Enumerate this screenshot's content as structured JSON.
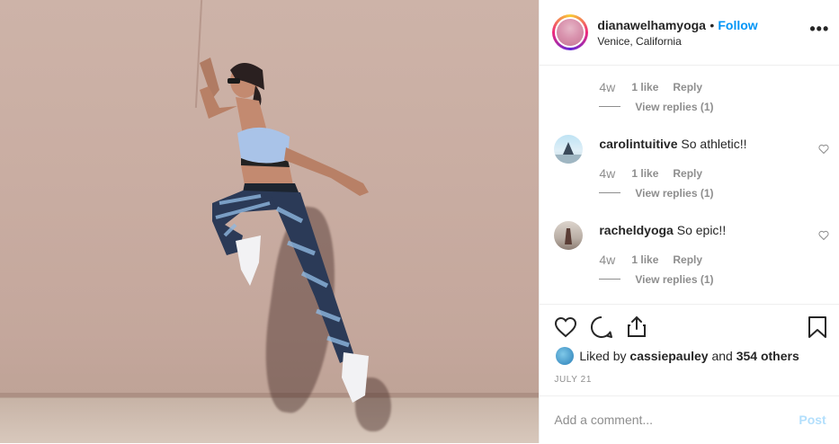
{
  "header": {
    "username": "dianawelhamyoga",
    "separator": "•",
    "follow_label": "Follow",
    "location": "Venice, California",
    "more_label": "•••"
  },
  "comments": [
    {
      "username": "",
      "text": "",
      "time": "4w",
      "likes": "1 like",
      "reply_label": "Reply",
      "view_replies": "View replies (1)"
    },
    {
      "username": "carolintuitive",
      "text": "So athletic!!",
      "time": "4w",
      "likes": "1 like",
      "reply_label": "Reply",
      "view_replies": "View replies (1)"
    },
    {
      "username": "racheldyoga",
      "text": "So epic!!",
      "time": "4w",
      "likes": "1 like",
      "reply_label": "Reply",
      "view_replies": "View replies (1)"
    }
  ],
  "actions": {
    "like_icon": "heart-icon",
    "comment_icon": "comment-icon",
    "share_icon": "share-icon",
    "save_icon": "bookmark-icon"
  },
  "likes": {
    "prefix": "Liked by",
    "user": "cassiepauley",
    "middle": "and",
    "others": "354 others"
  },
  "date": "JULY 21",
  "add_comment": {
    "placeholder": "Add a comment...",
    "post_label": "Post"
  },
  "colors": {
    "accent": "#0095f6",
    "post_disabled": "#b3dffc",
    "muted": "#8e8e8e",
    "text": "#262626"
  }
}
